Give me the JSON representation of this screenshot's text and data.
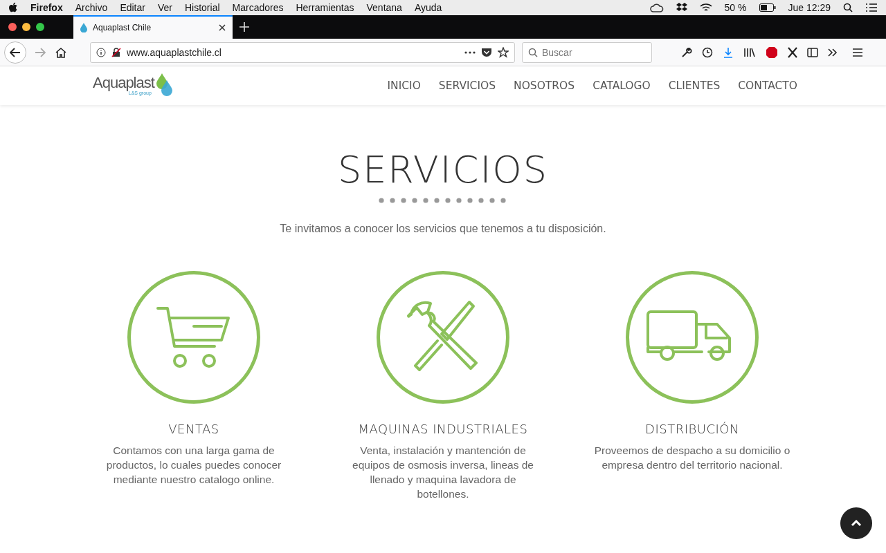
{
  "menu_bar": {
    "app": "Firefox",
    "items": [
      "Archivo",
      "Editar",
      "Ver",
      "Historial",
      "Marcadores",
      "Herramientas",
      "Ventana",
      "Ayuda"
    ],
    "battery": "50 %",
    "clock": "Jue 12:29"
  },
  "tabs": [
    {
      "label": "Aquaplast Chile",
      "selected": true
    }
  ],
  "toolbar": {
    "url": "www.aquaplastchile.cl",
    "search_placeholder": "Buscar"
  },
  "site": {
    "logo": "Aquaplast",
    "logo_sub": "L&S group",
    "nav": [
      "INICIO",
      "SERVICIOS",
      "NOSOTROS",
      "CATALOGO",
      "CLIENTES",
      "CONTACTO"
    ],
    "title": "SERVICIOS",
    "subtitle": "Te invitamos a conocer los servicios que tenemos a tu disposición.",
    "services": [
      {
        "kind": "cart",
        "title": "VENTAS",
        "text": "Contamos con una larga gama de productos, lo cuales puedes conocer mediante nuestro catalogo online."
      },
      {
        "kind": "tools",
        "title": "MAQUINAS INDUSTRIALES",
        "text": "Venta, instalación y mantención de equipos de osmosis inversa, lineas de llenado y maquina lavadora de botellones."
      },
      {
        "kind": "truck",
        "title": "DISTRIBUCIÓN",
        "text": "Proveemos de despacho a su domicilio o empresa dentro del territorio nacional."
      }
    ]
  }
}
